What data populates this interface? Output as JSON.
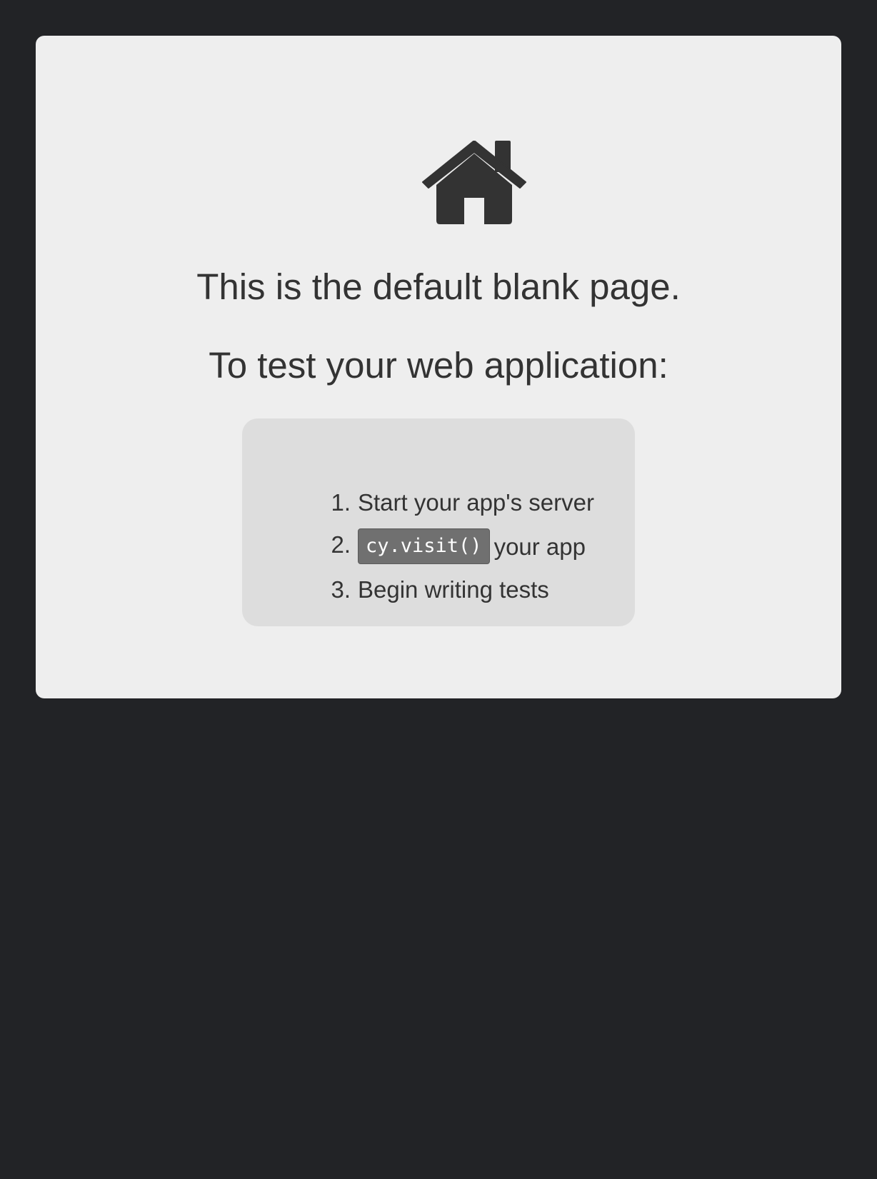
{
  "page": {
    "background_color": "#222326",
    "card_color": "#eeeeee",
    "steps_box_color": "#dddddd",
    "text_color": "#333333",
    "code_chip_color": "#707070"
  },
  "icon": "home-icon",
  "heading": "This is the default blank page.",
  "subheading": "To test your web application:",
  "steps": [
    {
      "number": "1.",
      "text": "Start your app's server"
    },
    {
      "number": "2.",
      "code": "cy.visit()",
      "text": "your app"
    },
    {
      "number": "3.",
      "text": "Begin writing tests"
    }
  ]
}
